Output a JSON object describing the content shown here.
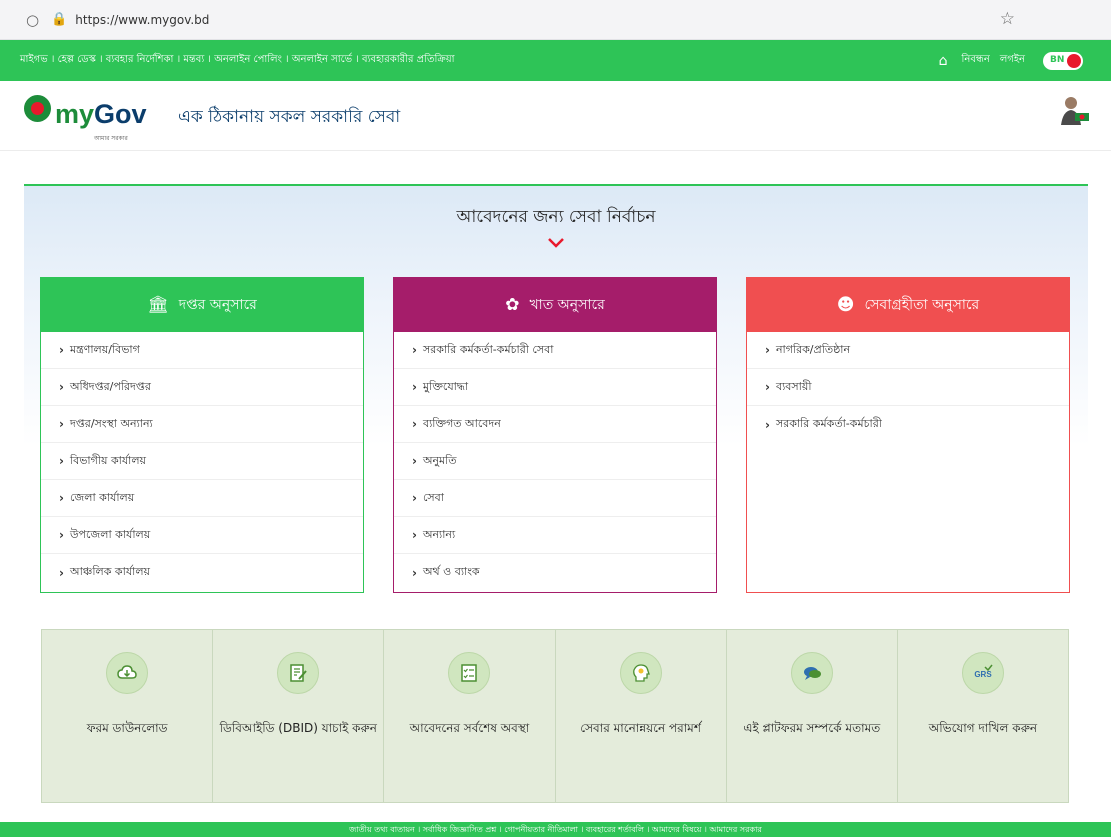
{
  "browser": {
    "url": "https://www.mygov.bd"
  },
  "topbar": {
    "links": "মাইগভ । হেল্প ডেস্ক । ব্যবহার নির্দেশিকা । মন্তব্য । অনলাইন পোলিং । অনলাইন সার্ভে । ব্যবহারকারীর প্রতিক্রিয়া",
    "register": "নিবন্ধন",
    "login": "লগইন",
    "lang": "BN",
    "colors": {
      "green": "#2ec457",
      "toggle_red": "#e8192c"
    }
  },
  "header": {
    "logo_my": "my",
    "logo_gov": "Gov",
    "logo_sub": "আমার সরকার",
    "tagline": "এক ঠিকানায় সকল সরকারি সেবা"
  },
  "main": {
    "title": "আবেদনের জন্য সেবা নির্বাচন",
    "cards": [
      {
        "heading": "দপ্তর অনুসারে",
        "icon": "building-icon",
        "color": "#2ec457",
        "items": [
          "মন্ত্রণালয়/বিভাগ",
          "অধিদপ্তর/পরিদপ্তর",
          "দপ্তর/সংস্থা অন্যান্য",
          "বিভাগীয় কার্যালয়",
          "জেলা কার্যালয়",
          "উপজেলা কার্যালয়",
          "আঞ্চলিক কার্যালয়"
        ]
      },
      {
        "heading": "খাত অনুসারে",
        "icon": "sectors-icon",
        "color": "#a51d6a",
        "items": [
          "সরকারি কর্মকর্তা-কর্মচারী সেবা",
          "মুক্তিযোদ্ধা",
          "ব্যক্তিগত আবেদন",
          "অনুমতি",
          "সেবা",
          "অন্যান্য",
          "অর্থ ও ব্যাংক"
        ]
      },
      {
        "heading": "সেবাগ্রহীতা অনুসারে",
        "icon": "users-icon",
        "color": "#f04f50",
        "items": [
          "নাগরিক/প্রতিষ্ঠান",
          "ব্যবসায়ী",
          "সরকারি কর্মকর্তা-কর্মচারী"
        ]
      }
    ]
  },
  "tiles": [
    {
      "label": "ফরম ডাউনলোড",
      "icon": "cloud-download-icon"
    },
    {
      "label": "ডিবিআইডি (DBID) যাচাই করুন",
      "icon": "document-edit-icon"
    },
    {
      "label": "আবেদনের সর্বশেষ অবস্থা",
      "icon": "checklist-icon"
    },
    {
      "label": "সেবার মানোন্নয়নে পরামর্শ",
      "icon": "idea-head-icon"
    },
    {
      "label": "এই প্লাটফরম সম্পর্কে মতামত",
      "icon": "chat-bubbles-icon"
    },
    {
      "label": "অভিযোগ দাখিল করুন",
      "icon": "grs-icon"
    }
  ],
  "tile_icon_text": {
    "grs": "GRS"
  },
  "footer": {
    "links": "জাতীয় তথ্য বাতায়ন । সর্বাধিক জিজ্ঞাসিত প্রশ্ন । গোপনীয়তার নীতিমালা । ব্যবহারের শর্তাবলি । আমাদের বিষয়ে । আমাদের সরকার"
  }
}
